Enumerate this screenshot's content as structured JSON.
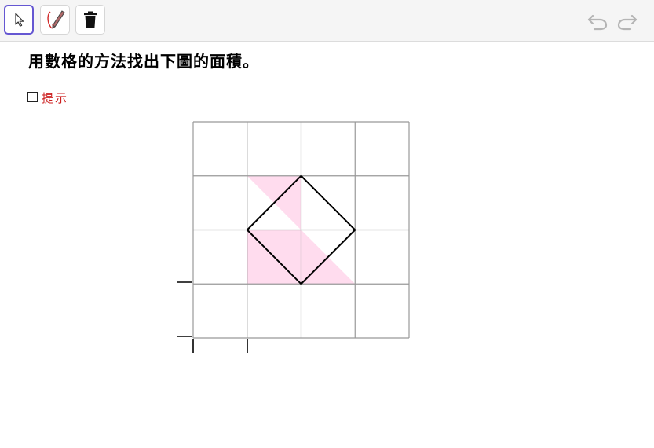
{
  "toolbar": {
    "tools": [
      {
        "name": "select-tool",
        "icon": "arrow-cursor-icon",
        "active": true
      },
      {
        "name": "pen-tool",
        "icon": "pen-icon",
        "active": false
      },
      {
        "name": "delete-tool",
        "icon": "trash-icon",
        "active": false
      }
    ],
    "history": {
      "undo_icon": "undo-icon",
      "redo_icon": "redo-icon"
    }
  },
  "question": {
    "text": "用數格的方法找出下圖的面積。"
  },
  "hint": {
    "checked": false,
    "label": "提示"
  },
  "figure": {
    "grid": {
      "cols": 4,
      "rows": 4
    },
    "square_vertices": [
      [
        2,
        3
      ],
      [
        3,
        2
      ],
      [
        2,
        1
      ],
      [
        1,
        2
      ]
    ],
    "shaded_cells": [
      {
        "col": 1,
        "row": 2,
        "part": "full"
      },
      {
        "col": 2,
        "row": 2,
        "part": "lower-left-triangle"
      },
      {
        "col": 1,
        "row": 1,
        "part": "upper-right-triangle"
      }
    ],
    "colors": {
      "grid_line": "#999999",
      "shade": "#ffdcee",
      "square_outline": "#000000",
      "accent": "#6557d2",
      "hint_text": "#cc1f1f"
    }
  }
}
